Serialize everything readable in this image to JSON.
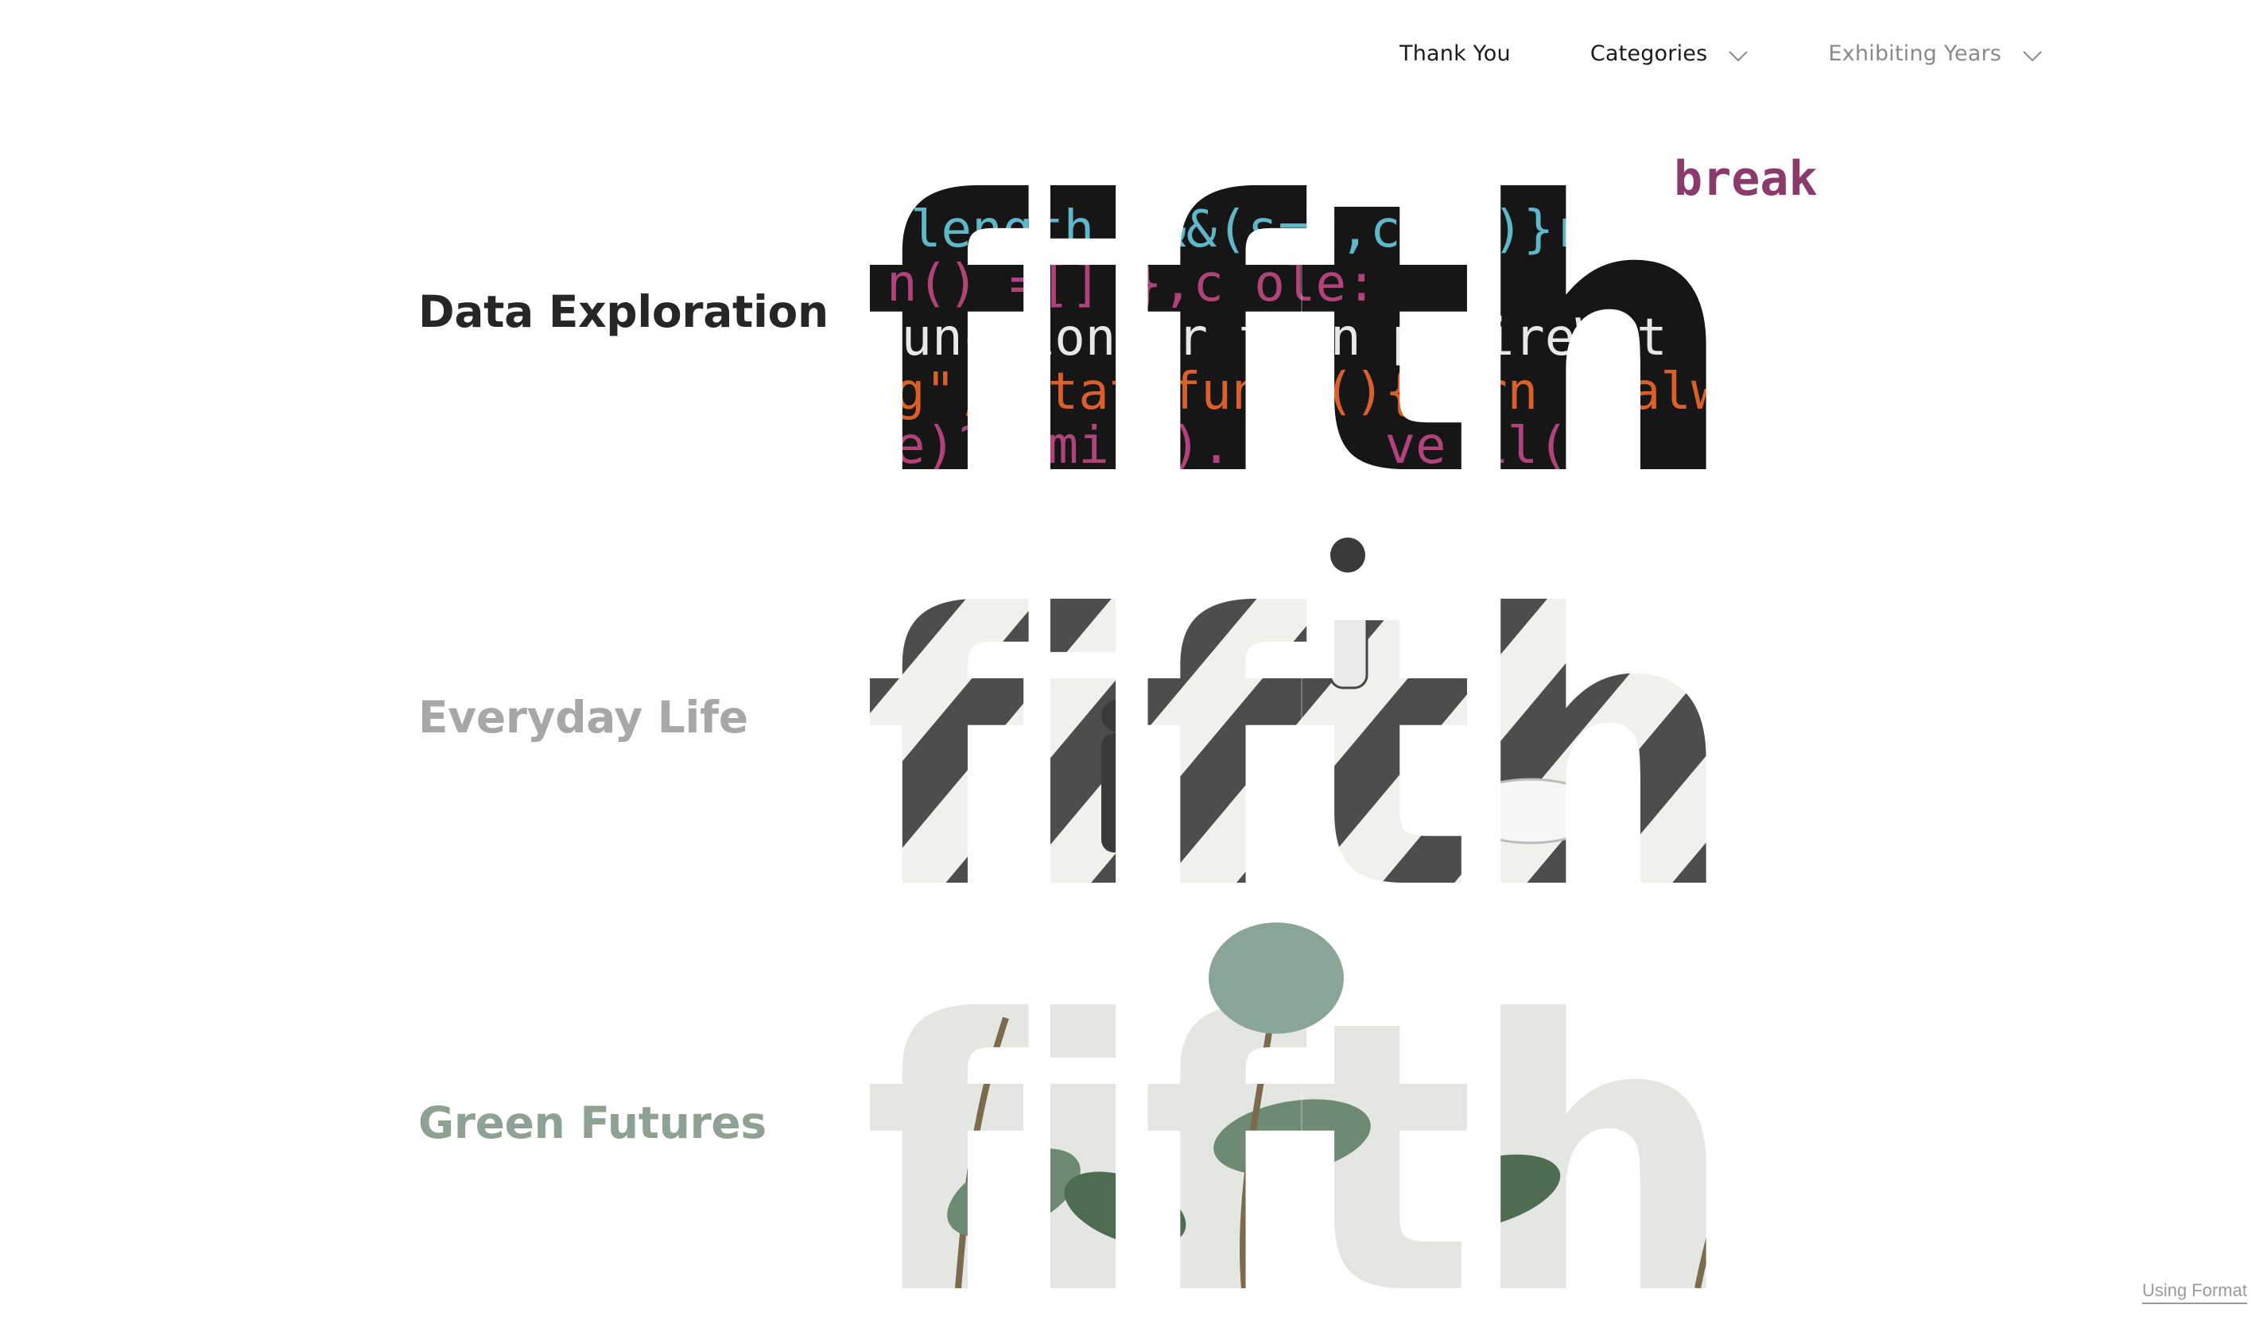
{
  "nav": {
    "thank_you": "Thank You",
    "categories": "Categories",
    "exhibiting_years": "Exhibiting Years"
  },
  "rows": [
    {
      "title": "Data Exploration",
      "word": "fifth",
      "theme": "code"
    },
    {
      "title": "Everyday Life",
      "word": "fifth",
      "theme": "crosswalk"
    },
    {
      "title": "Green Futures",
      "word": "fifth",
      "theme": "plants"
    }
  ],
  "code_snippets": {
    "overlay": "break",
    "line1": "length r&&(s=t,c(r))}return th",
    "line2": "n()   =[]   },c  ole:",
    "line3": "function){r turn p fireWit (this,arg",
    "line4": "g\",  stat  fun  n(){  urn r)alw",
    "line5": "e)?  omi   ().  (n.    ve   il("
  },
  "colors": {
    "code_bg": "#161616",
    "code_magenta": "#b0447a",
    "code_cyan": "#5fb7c9",
    "code_white": "#e8e8e8",
    "code_orange": "#d9602a",
    "stripe_dark": "#4d4d4d",
    "stripe_light": "#f1f0ec",
    "plant_bg": "#e3e6e1",
    "leaf": "#6f8a72",
    "leaf_dark": "#4f6b52"
  },
  "footer": {
    "badge": "Using Format"
  }
}
